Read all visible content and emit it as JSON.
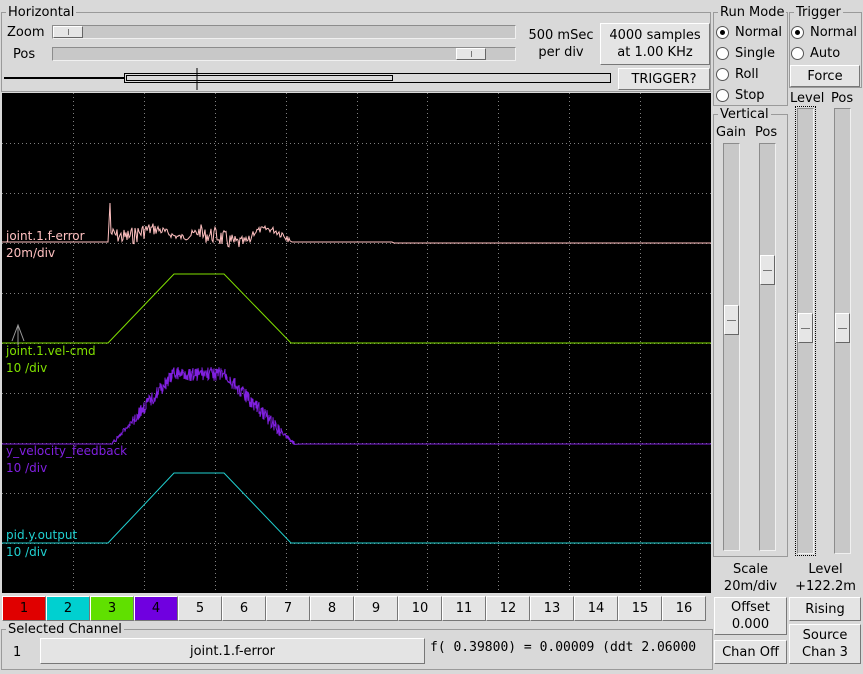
{
  "horizontal": {
    "title": "Horizontal",
    "zoom_label": "Zoom",
    "zoom_level": 0.0,
    "pos_label": "Pos",
    "pos_level": 0.92,
    "time_per_div": "500 mSec\nper div",
    "samples_button": "4000 samples\nat 1.00 KHz",
    "trigger_status_button": "TRIGGER?"
  },
  "run_mode": {
    "title": "Run Mode",
    "options": [
      {
        "label": "Normal",
        "selected": true
      },
      {
        "label": "Single",
        "selected": false
      },
      {
        "label": "Roll",
        "selected": false
      },
      {
        "label": "Stop",
        "selected": false
      }
    ]
  },
  "trigger": {
    "title": "Trigger",
    "options": [
      {
        "label": "Normal",
        "selected": true
      },
      {
        "label": "Auto",
        "selected": false
      }
    ],
    "force_button": "Force",
    "level_label": "Level",
    "pos_label": "Pos",
    "level_value_label": "Level\n+122.2m",
    "edge_button": "Rising",
    "source_button": "Source\nChan  3"
  },
  "vertical": {
    "title": "Vertical",
    "gain_label": "Gain",
    "pos_label": "Pos",
    "scale_label": "Scale\n20m/div",
    "offset_button": "Offset\n0.000",
    "chan_off_button": "Chan Off"
  },
  "traces": [
    {
      "name": "joint.1.f-error",
      "scale": "20m/div",
      "color": "#ffc0c0"
    },
    {
      "name": "joint.1.vel-cmd",
      "scale": "10 /div",
      "color": "#80e000"
    },
    {
      "name": "y_velocity_feedback",
      "scale": "10 /div",
      "color": "#8020e0"
    },
    {
      "name": "pid.y.output",
      "scale": "10 /div",
      "color": "#20d0d0"
    }
  ],
  "channels": [
    "1",
    "2",
    "3",
    "4",
    "5",
    "6",
    "7",
    "8",
    "9",
    "10",
    "11",
    "12",
    "13",
    "14",
    "15",
    "16"
  ],
  "channel_colors": {
    "1": "#e00000",
    "2": "#00d0d0",
    "3": "#60e000",
    "4": "#7000e0"
  },
  "selected_channel": {
    "title": "Selected Channel",
    "number": "1",
    "name": "joint.1.f-error",
    "readout": "f( 0.39800) =  0.00009 (ddt  2.06000"
  }
}
